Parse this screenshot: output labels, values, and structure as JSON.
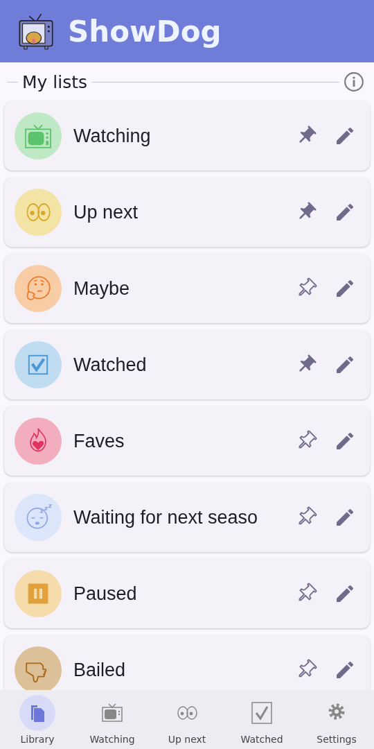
{
  "app_bar": {
    "title": "ShowDog"
  },
  "section": {
    "title": "My lists"
  },
  "lists": [
    {
      "name": "Watching",
      "kind": "tv",
      "color": "#bfe8c4",
      "pinned": true
    },
    {
      "name": "Up next",
      "kind": "eyes",
      "color": "#f3e4a6",
      "pinned": true
    },
    {
      "name": "Maybe",
      "kind": "thinking",
      "color": "#f8cda6",
      "pinned": false
    },
    {
      "name": "Watched",
      "kind": "check",
      "color": "#c0dcf0",
      "pinned": true
    },
    {
      "name": "Faves",
      "kind": "fire",
      "color": "#f2aebe",
      "pinned": false
    },
    {
      "name": "Waiting for next seaso",
      "kind": "sleepy",
      "color": "#dbe6fb",
      "pinned": false
    },
    {
      "name": "Paused",
      "kind": "pause",
      "color": "#f6dcaa",
      "pinned": false
    },
    {
      "name": "Bailed",
      "kind": "thumbsdown",
      "color": "#dcc098",
      "pinned": false
    }
  ],
  "nav": [
    {
      "label": "Library",
      "kind": "library",
      "selected": true
    },
    {
      "label": "Watching",
      "kind": "tv",
      "selected": false
    },
    {
      "label": "Up next",
      "kind": "eyes",
      "selected": false
    },
    {
      "label": "Watched",
      "kind": "check",
      "selected": false
    },
    {
      "label": "Settings",
      "kind": "settings",
      "selected": false
    }
  ]
}
